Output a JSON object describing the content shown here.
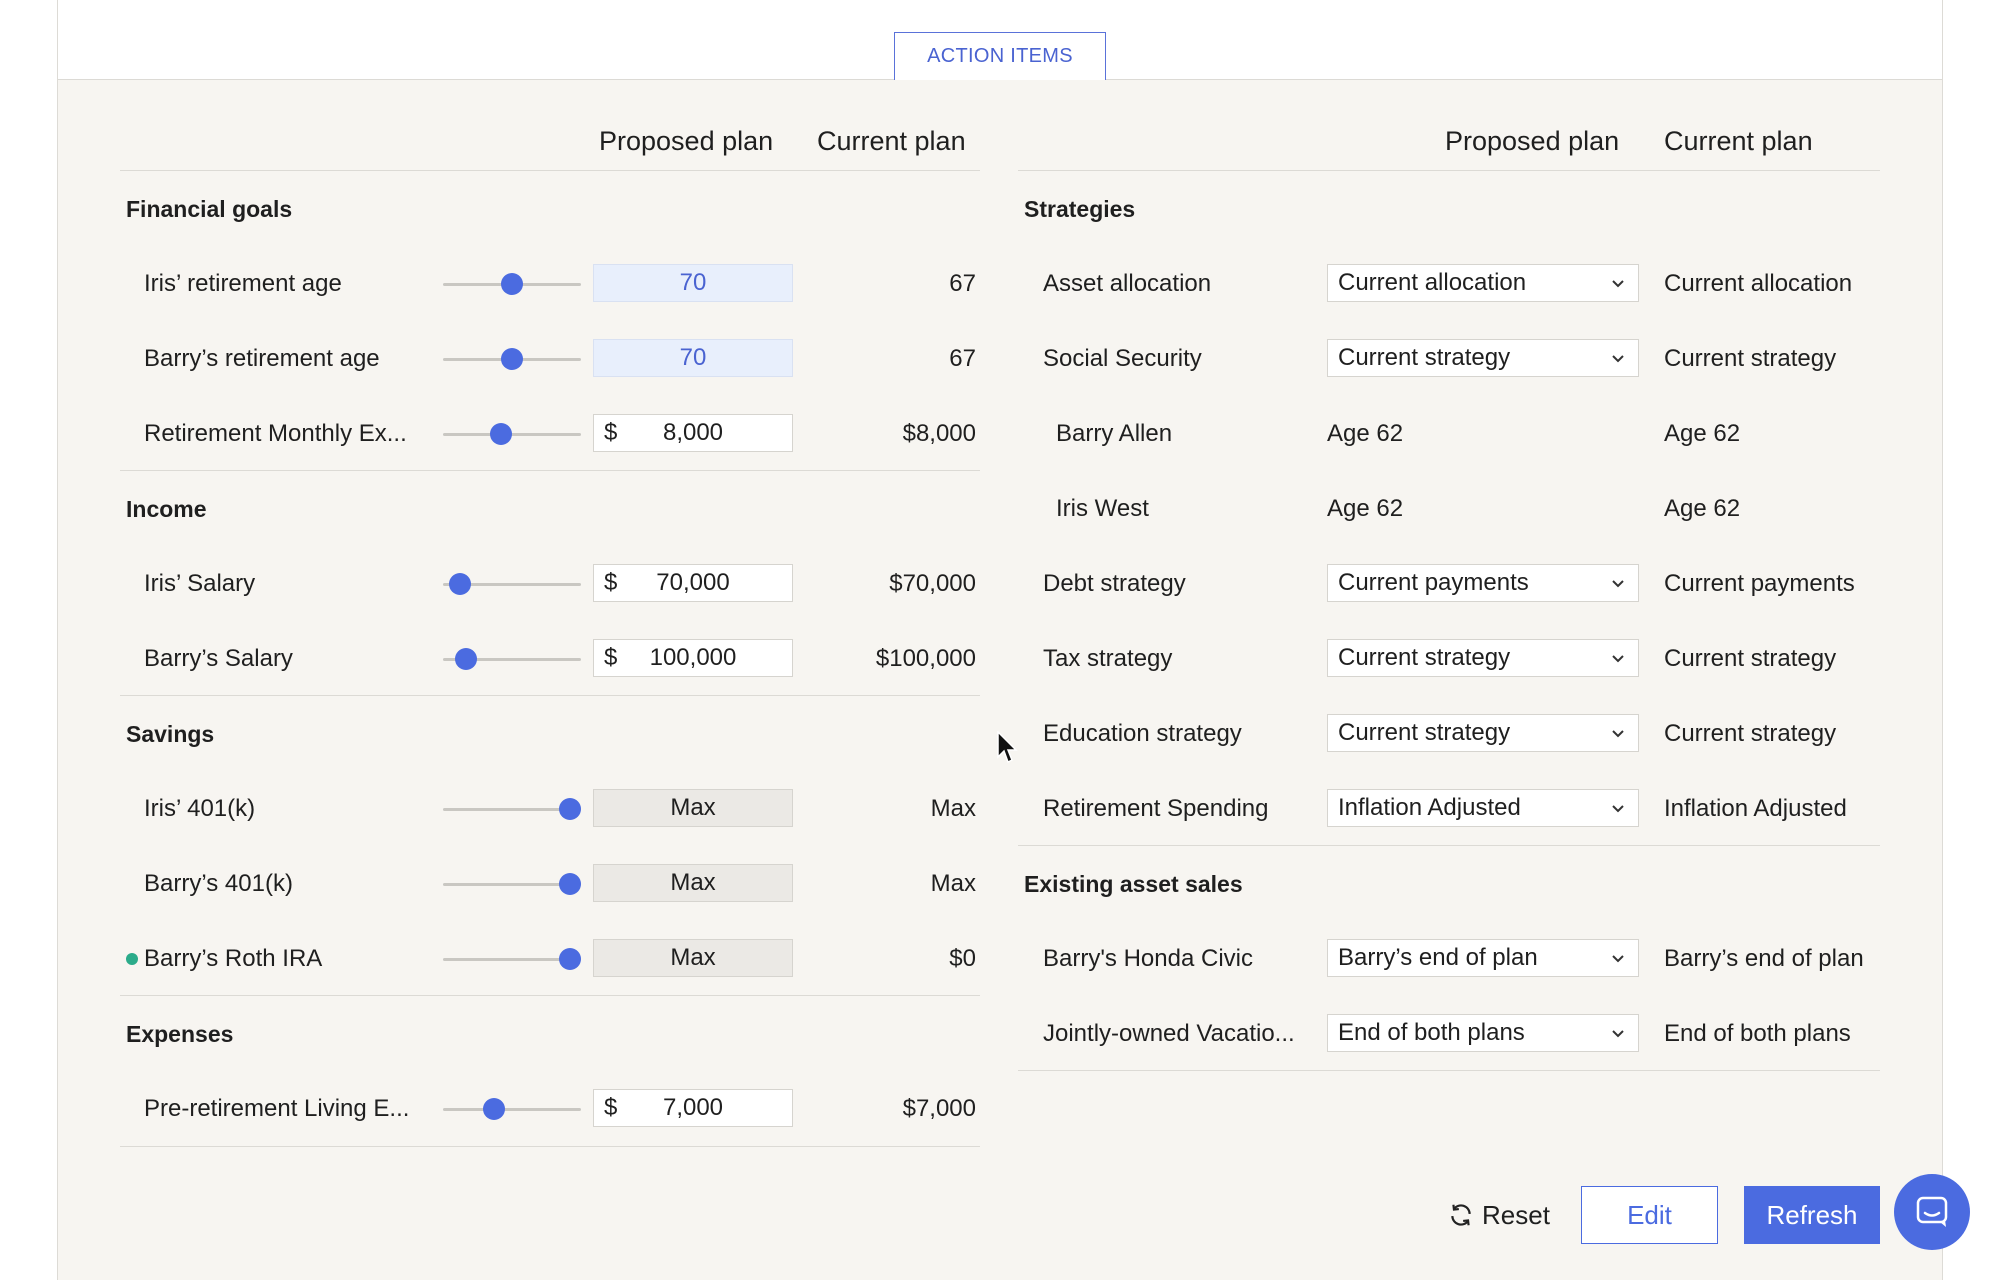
{
  "tab": {
    "label": "ACTION ITEMS"
  },
  "left": {
    "headers": {
      "proposed": "Proposed plan",
      "current": "Current plan"
    },
    "financial_goals": {
      "title": "Financial goals",
      "rows": [
        {
          "label": "Iris’ retirement age",
          "proposed": "70",
          "current": "67",
          "slider": 0.5
        },
        {
          "label": "Barry’s retirement age",
          "proposed": "70",
          "current": "67",
          "slider": 0.5
        },
        {
          "label": "Retirement Monthly Ex...",
          "currency": "$",
          "proposed": "8,000",
          "current": "$8,000",
          "slider": 0.42
        }
      ]
    },
    "income": {
      "title": "Income",
      "rows": [
        {
          "label": "Iris’ Salary",
          "currency": "$",
          "proposed": "70,000",
          "current": "$70,000",
          "slider": 0.12
        },
        {
          "label": "Barry’s Salary",
          "currency": "$",
          "proposed": "100,000",
          "current": "$100,000",
          "slider": 0.17
        }
      ]
    },
    "savings": {
      "title": "Savings",
      "rows": [
        {
          "label": "Iris’ 401(k)",
          "proposed": "Max",
          "current": "Max",
          "slider": 0.92
        },
        {
          "label": "Barry’s 401(k)",
          "proposed": "Max",
          "current": "Max",
          "slider": 0.92
        },
        {
          "label": "Barry’s Roth IRA",
          "proposed": "Max",
          "current": "$0",
          "slider": 0.92
        }
      ]
    },
    "expenses": {
      "title": "Expenses",
      "rows": [
        {
          "label": "Pre-retirement Living E...",
          "currency": "$",
          "proposed": "7,000",
          "current": "$7,000",
          "slider": 0.37
        }
      ]
    }
  },
  "right": {
    "headers": {
      "proposed": "Proposed plan",
      "current": "Current plan"
    },
    "strategies": {
      "title": "Strategies",
      "rows": [
        {
          "label": "Asset allocation",
          "proposed": "Current allocation",
          "current": "Current allocation"
        },
        {
          "label": "Social Security",
          "proposed": "Current strategy",
          "current": "Current strategy"
        },
        {
          "label": "Barry Allen",
          "proposed": "Age 62",
          "current": "Age 62"
        },
        {
          "label": "Iris West",
          "proposed": "Age 62",
          "current": "Age 62"
        },
        {
          "label": "Debt strategy",
          "proposed": "Current payments",
          "current": "Current payments"
        },
        {
          "label": "Tax strategy",
          "proposed": "Current strategy",
          "current": "Current strategy"
        },
        {
          "label": "Education strategy",
          "proposed": "Current strategy",
          "current": "Current strategy"
        },
        {
          "label": "Retirement Spending",
          "proposed": "Inflation Adjusted",
          "current": "Inflation Adjusted"
        }
      ]
    },
    "asset_sales": {
      "title": "Existing asset sales",
      "rows": [
        {
          "label": "Barry's Honda Civic",
          "proposed": "Barry’s end of plan",
          "current": "Barry’s end of plan"
        },
        {
          "label": "Jointly-owned Vacatio...",
          "proposed": "End of both plans",
          "current": "End of both plans"
        }
      ]
    }
  },
  "footer": {
    "reset": "Reset",
    "edit": "Edit",
    "refresh": "Refresh"
  },
  "colors": {
    "accent": "#4b6be0",
    "panel": "#f7f5f1",
    "roth_dot": "#2bab8a"
  },
  "icons": {
    "reset": "refresh-icon",
    "chat": "chat-icon",
    "select": "chevron-down-icon"
  }
}
